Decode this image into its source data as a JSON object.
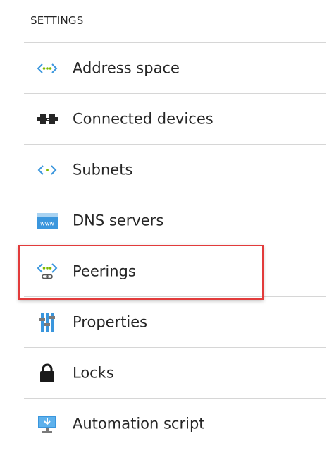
{
  "settings": {
    "header": "SETTINGS",
    "items": [
      {
        "label": "Address space",
        "icon": "address-space-icon"
      },
      {
        "label": "Connected devices",
        "icon": "connected-devices-icon"
      },
      {
        "label": "Subnets",
        "icon": "subnets-icon"
      },
      {
        "label": "DNS servers",
        "icon": "dns-servers-icon"
      },
      {
        "label": "Peerings",
        "icon": "peerings-icon"
      },
      {
        "label": "Properties",
        "icon": "properties-icon"
      },
      {
        "label": "Locks",
        "icon": "lock-icon"
      },
      {
        "label": "Automation script",
        "icon": "automation-script-icon"
      }
    ]
  },
  "colors": {
    "accent_blue": "#3a96dd",
    "accent_green": "#7fba00",
    "highlight_border": "#e23b3b",
    "divider": "#d6d6d6"
  }
}
